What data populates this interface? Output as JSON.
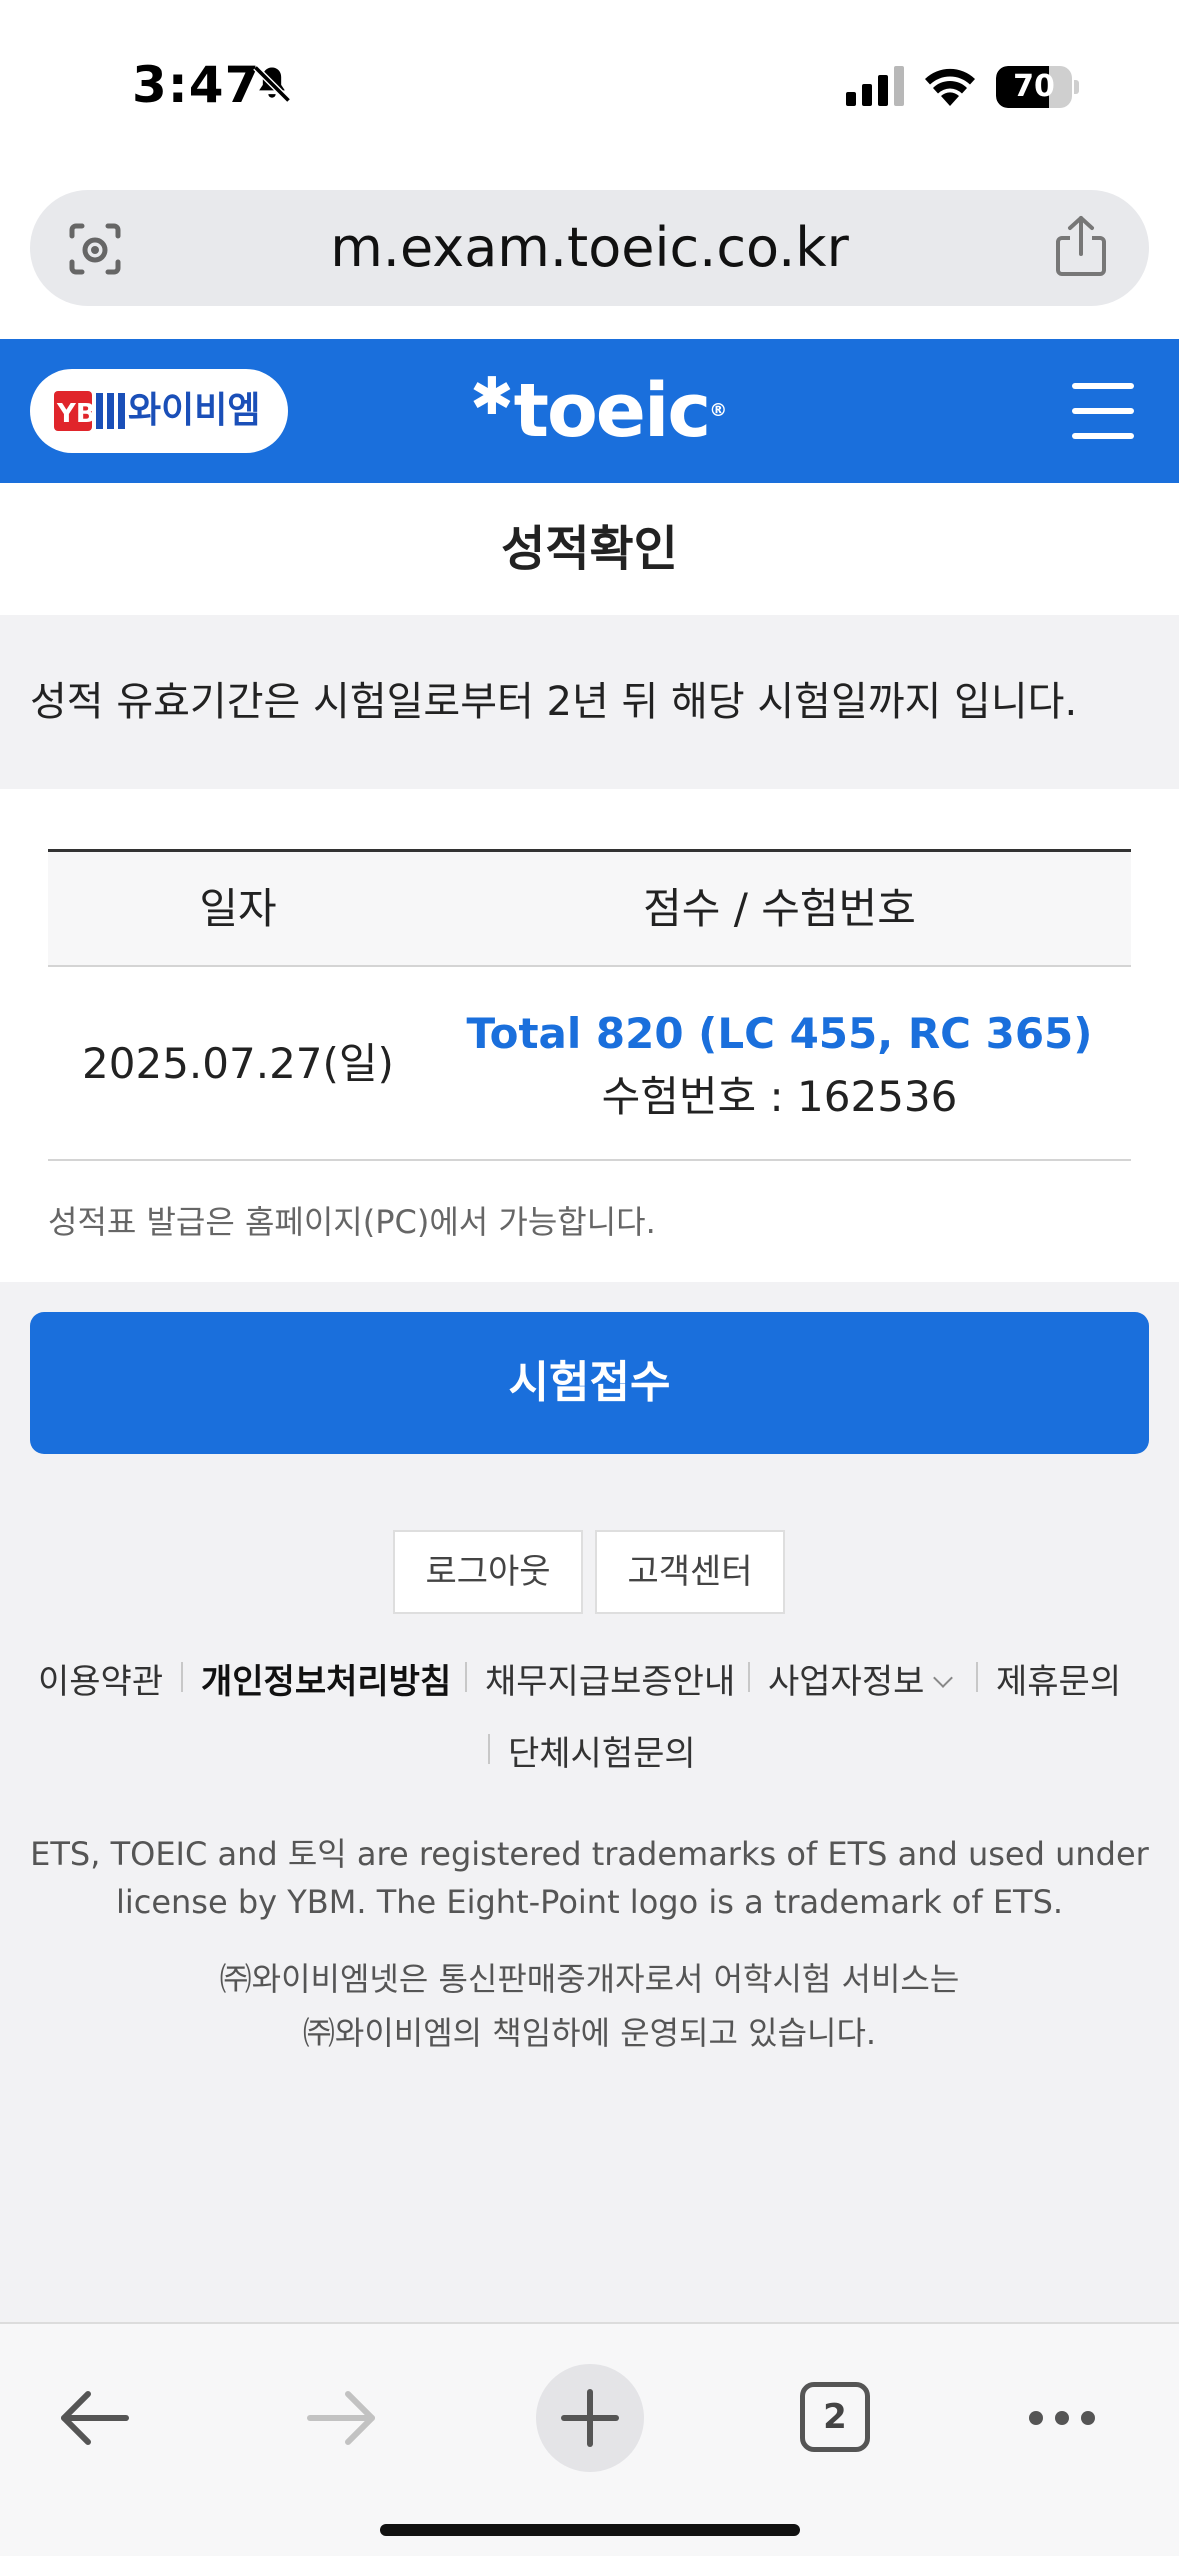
{
  "status_bar": {
    "time": "3:47",
    "battery": "70",
    "battery_level": 0.7
  },
  "browser": {
    "url": "m.exam.toeic.co.kr",
    "tab_count": "2"
  },
  "header": {
    "ybm_logo_text": "와이비엠",
    "ybm_logo_mark": "YBM",
    "toeic_logo": "toeic",
    "colors": {
      "brand_blue": "#1a6fdc",
      "ybm_red": "#e0252b"
    }
  },
  "page": {
    "title": "성적확인",
    "notice": "성적 유효기간은 시험일로부터 2년 뒤 해당 시험일까지 입니다."
  },
  "score_table": {
    "headers": [
      "일자",
      "점수 / 수험번호"
    ],
    "rows": [
      {
        "date": "2025.07.27(일)",
        "score": "Total 820 (LC 455, RC 365)",
        "exam_number": "수험번호 : 162536"
      }
    ],
    "note": "성적표 발급은 홈페이지(PC)에서 가능합니다."
  },
  "actions": {
    "apply_label": "시험접수",
    "logout_label": "로그아웃",
    "customer_center_label": "고객센터"
  },
  "footer": {
    "links": [
      "이용약관",
      "개인정보처리방침",
      "채무지급보증안내",
      "사업자정보",
      "제휴문의",
      "단체시험문의"
    ],
    "legal_en_1": "ETS, TOEIC and 토익 are registered trademarks of ETS and used under",
    "legal_en_2": "license by YBM. The Eight-Point logo is a trademark of ETS.",
    "legal_ko_1": "㈜와이비엠넷은 통신판매중개자로서 어학시험 서비스는",
    "legal_ko_2": "㈜와이비엠의 책임하에 운영되고 있습니다."
  },
  "icons": [
    "bell-slash-icon",
    "signal-icon",
    "wifi-icon",
    "battery-icon",
    "camera-search-icon",
    "share-icon",
    "menu-icon",
    "back-arrow-icon",
    "forward-arrow-icon",
    "plus-icon",
    "tabs-icon",
    "more-icon",
    "chevron-down-icon"
  ]
}
